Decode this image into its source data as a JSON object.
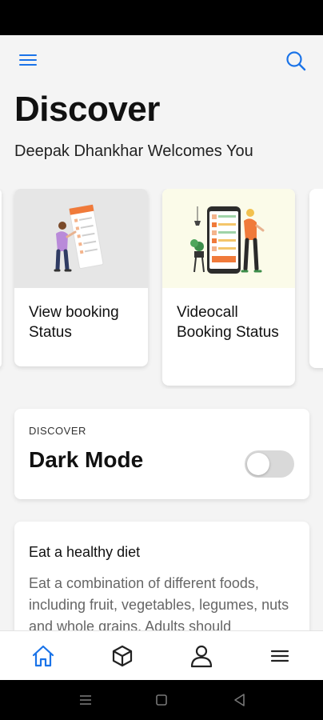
{
  "header": {
    "menu_icon": "hamburger-menu-icon",
    "search_icon": "search-icon",
    "accent_color": "#1a73e8"
  },
  "page": {
    "title": "Discover",
    "subtitle": "Deepak Dhankhar Welcomes You"
  },
  "carousel": {
    "cards": [
      {
        "label": "View booking Status",
        "illustration": "woman-reading-document-illustration"
      },
      {
        "label": "Videocall Booking Status",
        "illustration": "man-with-phone-checklist-illustration"
      }
    ]
  },
  "dark_mode": {
    "kicker": "DISCOVER",
    "title": "Dark Mode",
    "enabled": false
  },
  "tip": {
    "title": "Eat a healthy diet",
    "body": "Eat a combination of different foods, including fruit, vegetables, legumes, nuts and whole grains. Adults should"
  },
  "bottom_nav": {
    "items": [
      {
        "icon": "home-icon",
        "active": true
      },
      {
        "icon": "cube-icon",
        "active": false
      },
      {
        "icon": "user-icon",
        "active": false
      },
      {
        "icon": "menu-icon",
        "active": false
      }
    ]
  },
  "system_nav": {
    "items": [
      "recents-icon",
      "home-square-icon",
      "back-icon"
    ]
  }
}
